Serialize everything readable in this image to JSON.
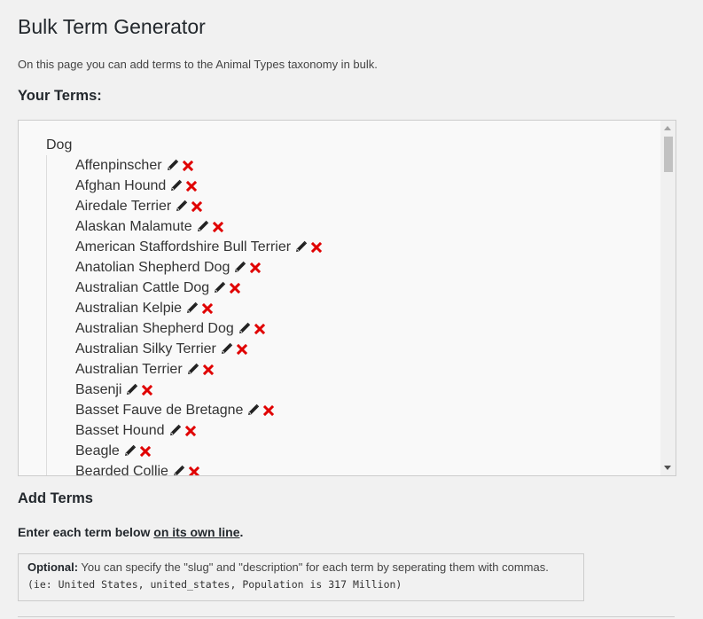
{
  "page": {
    "title": "Bulk Term Generator",
    "intro": "On this page you can add terms to the Animal Types taxonomy in bulk."
  },
  "your_terms": {
    "heading": "Your Terms:",
    "parent": "Dog",
    "terms": [
      "Affenpinscher",
      "Afghan Hound",
      "Airedale Terrier",
      "Alaskan Malamute",
      "American Staffordshire Bull Terrier",
      "Anatolian Shepherd Dog",
      "Australian Cattle Dog",
      "Australian Kelpie",
      "Australian Shepherd Dog",
      "Australian Silky Terrier",
      "Australian Terrier",
      "Basenji",
      "Basset Fauve de Bretagne",
      "Basset Hound",
      "Beagle",
      "Bearded Collie"
    ],
    "icons": {
      "edit": "pencil-icon",
      "delete": "x-icon"
    },
    "colors": {
      "delete": "#e00000",
      "edit": "#222222"
    }
  },
  "add_terms": {
    "heading": "Add Terms",
    "instruction_prefix": "Enter each term below ",
    "instruction_link": "on its own line",
    "instruction_suffix": ".",
    "optional_label": "Optional:",
    "optional_text": " You can specify the \"slug\" and \"description\" for each term by seperating them with commas.",
    "example": "(ie: United States, united_states, Population is 317 Million)"
  }
}
